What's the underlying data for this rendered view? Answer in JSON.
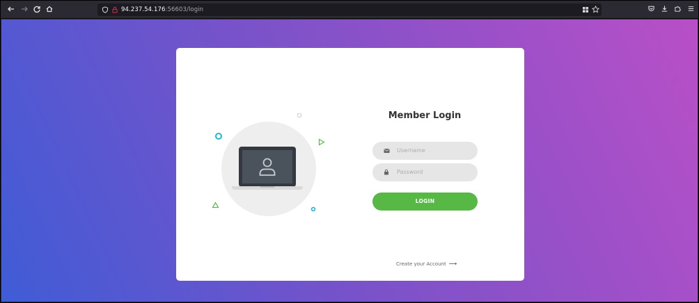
{
  "browser": {
    "back_icon": "arrow-left-icon",
    "forward_icon": "arrow-right-icon",
    "reload_icon": "reload-icon",
    "home_icon": "home-icon",
    "url_host": "94.237.54.176",
    "url_rest": ":56603/login",
    "toolbar_icons": [
      "extensions-grid-icon",
      "bookmark-star-icon",
      "pocket-icon",
      "download-icon",
      "extensions-icon",
      "menu-icon"
    ]
  },
  "login": {
    "title": "Member Login",
    "username_placeholder": "Username",
    "password_placeholder": "Password",
    "login_label": "LOGIN",
    "create_account_label": "Create your Account",
    "create_account_arrow": "⟶"
  },
  "colors": {
    "gradient_start": "#3f5cd6",
    "gradient_end": "#b94fc7",
    "button_green": "#57b846",
    "accent_cyan": "#1fb6d6",
    "accent_green": "#57b846"
  }
}
